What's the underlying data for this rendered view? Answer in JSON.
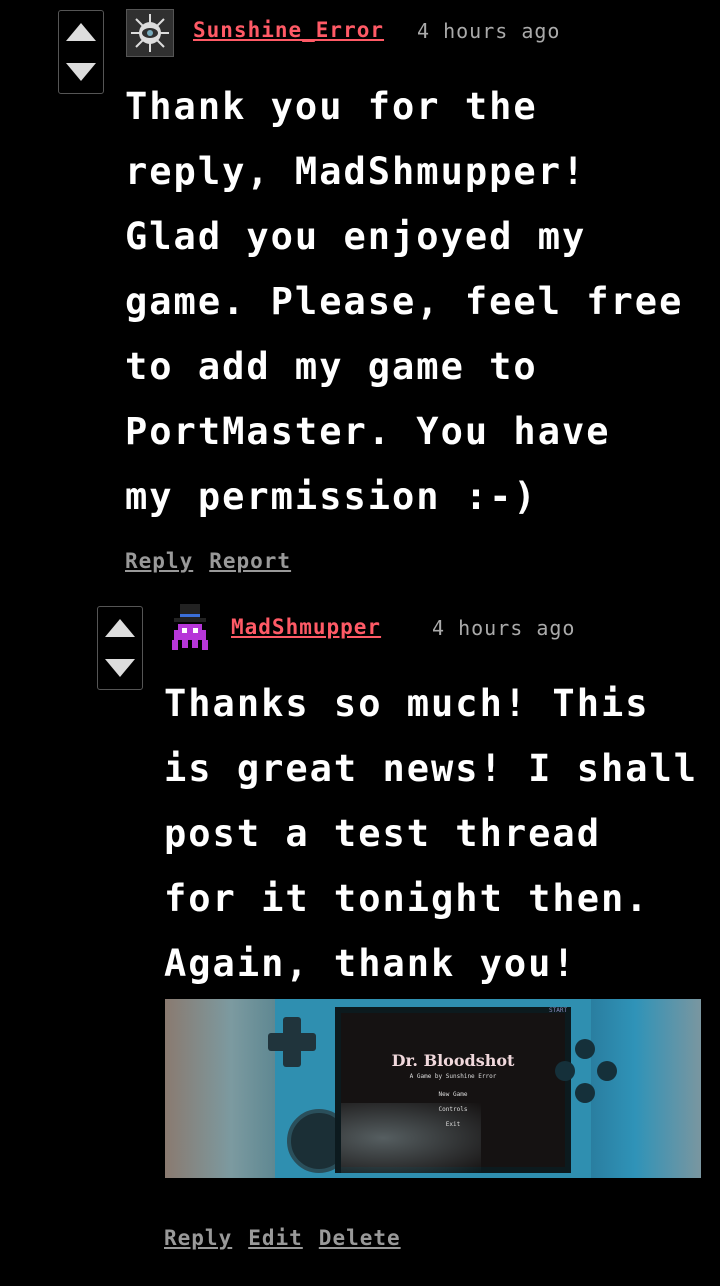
{
  "comments": [
    {
      "author": "Sunshine_Error",
      "time": "4 hours ago",
      "body": "Thank you for the\nreply, MadShmupper!\nGlad you enjoyed my\ngame. Please, feel free\nto add my game to\nPortMaster. You have\nmy permission :-)",
      "actions": [
        "Reply",
        "Report"
      ],
      "avatar_icon": "eye-emblem-icon"
    },
    {
      "author": "MadShmupper",
      "time": "4 hours ago",
      "body": "Thanks so much! This\nis great news! I shall\npost a test thread\nfor it tonight then.\nAgain, thank you!",
      "actions": [
        "Reply",
        "Edit",
        "Delete"
      ],
      "avatar_icon": "purple-invader-top-hat-icon",
      "image": {
        "game_title": "Dr. Bloodshot",
        "subtitle": "A Game by Sunshine Error",
        "menu": [
          "New Game",
          "Controls",
          "Exit"
        ],
        "device_label": "START"
      }
    }
  ],
  "colors": {
    "background": "#000000",
    "username": "#ff5a66",
    "muted": "#aaaaaa",
    "text": "#ffffff"
  }
}
